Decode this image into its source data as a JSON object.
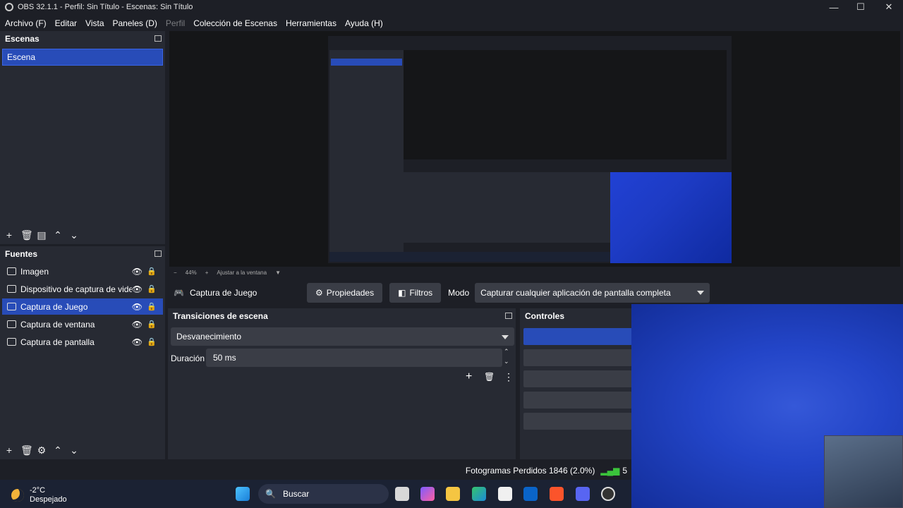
{
  "window": {
    "title": "OBS 32.1.1 - Perfil: Sin Título - Escenas: Sin Título"
  },
  "menu": [
    "Archivo (F)",
    "Editar",
    "Vista",
    "Paneles (D)",
    "Perfil",
    "Colección de Escenas",
    "Herramientas",
    "Ayuda (H)"
  ],
  "scenes": {
    "title": "Escenas",
    "items": [
      "Escena"
    ]
  },
  "sources": {
    "title": "Fuentes",
    "items": [
      "Imagen",
      "Dispositivo de captura de video",
      "Captura de Juego",
      "Captura de ventana",
      "Captura de pantalla"
    ],
    "selected": "Captura de Juego"
  },
  "zoom": {
    "value": "44%",
    "fit": "Ajustar a la ventana"
  },
  "source_bar": {
    "name": "Captura de Juego",
    "properties": "Propiedades",
    "filters": "Filtros",
    "mode_label": "Modo",
    "mode_value": "Capturar cualquier aplicación de pantalla completa"
  },
  "transitions": {
    "title": "Transiciones de escena",
    "selected": "Desvanecimiento",
    "duration_label": "Duración",
    "duration_value": "50 ms"
  },
  "controls": {
    "title": "Controles"
  },
  "status": {
    "dropped": "Fotogramas Perdidos 1846 (2.0%)",
    "extra": "5"
  },
  "taskbar": {
    "temp": "-2°C",
    "weather": "Despejado",
    "search": "Buscar"
  },
  "colors": {
    "accent": "#284cb8",
    "panel": "#272a33",
    "background": "#1d1f26"
  }
}
